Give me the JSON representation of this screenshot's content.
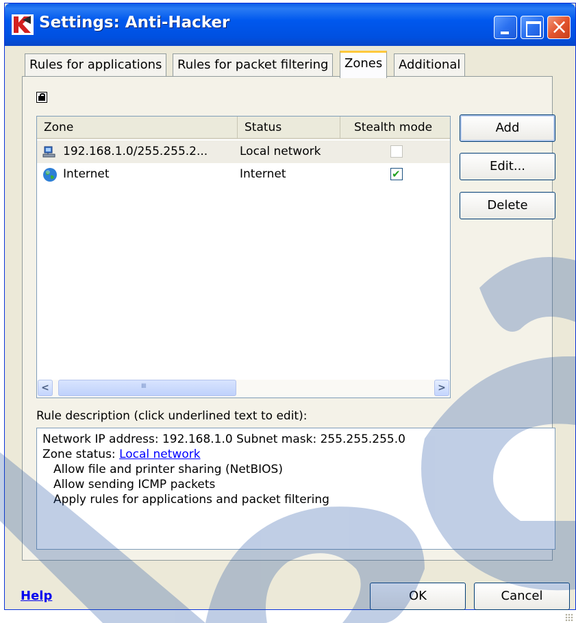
{
  "window": {
    "title": "Settings: Anti-Hacker"
  },
  "tabs": [
    {
      "label": "Rules for applications",
      "active": false
    },
    {
      "label": "Rules for packet filtering",
      "active": false
    },
    {
      "label": "Zones",
      "active": true
    },
    {
      "label": "Additional",
      "active": false
    }
  ],
  "zones_list": {
    "columns": [
      "Zone",
      "Status",
      "Stealth mode"
    ],
    "rows": [
      {
        "zone": "192.168.1.0/255.255.2...",
        "status": "Local network",
        "stealth": false,
        "icon": "network-icon",
        "selected": true
      },
      {
        "zone": "Internet",
        "status": "Internet",
        "stealth": true,
        "icon": "globe-icon",
        "selected": false
      }
    ],
    "scrollbar_grip": "IIII"
  },
  "side_buttons": {
    "add": "Add",
    "edit": "Edit...",
    "delete": "Delete"
  },
  "description": {
    "label": "Rule description (click underlined text to edit):",
    "line1": "Network IP address: 192.168.1.0   Subnet mask: 255.255.255.0",
    "zone_status_prefix": "Zone status: ",
    "zone_status_link": "Local network",
    "line3": "Allow file and printer sharing (NetBIOS)",
    "line4": "Allow sending ICMP packets",
    "line5": "Apply rules for applications and packet filtering"
  },
  "footer": {
    "help": "Help",
    "ok": "OK",
    "cancel": "Cancel"
  },
  "colors": {
    "titlebar": "#0058EE",
    "dialog_bg": "#ECE9D8",
    "watermark": "#1E4FA3"
  }
}
